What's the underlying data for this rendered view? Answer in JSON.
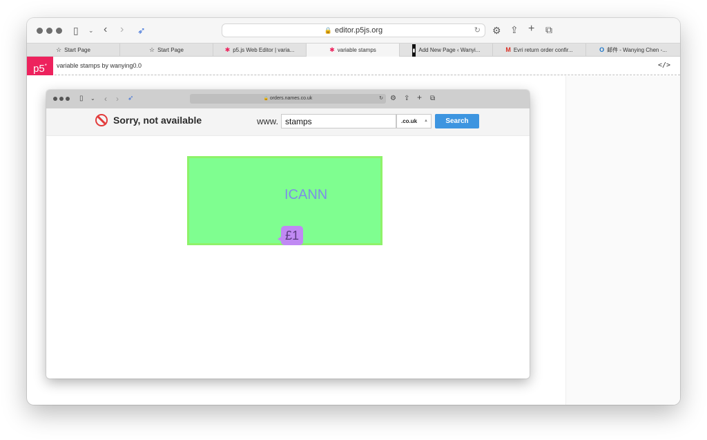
{
  "outer": {
    "url": "editor.p5js.org",
    "tabs": [
      {
        "label": "Start Page",
        "icon": "star-icon"
      },
      {
        "label": "Start Page",
        "icon": "star-icon"
      },
      {
        "label": "p5.js Web Editor | varia...",
        "icon": "p5-asterisk-icon"
      },
      {
        "label": "variable stamps",
        "icon": "p5-asterisk-icon",
        "active": true
      },
      {
        "label": "Add New Page ‹ Wanyi...",
        "icon": "wordpress-icon"
      },
      {
        "label": "Evri return order confir...",
        "icon": "gmail-icon"
      },
      {
        "label": "邮件 - Wanying Chen -...",
        "icon": "outlook-icon"
      }
    ]
  },
  "p5": {
    "logo": "p5",
    "logo_sup": "*",
    "sketch_title": "variable stamps by wanying0.0",
    "code_toggle": "</>"
  },
  "inner": {
    "url": "orders.names.co.uk",
    "sorry_text": "Sorry, not available",
    "www_label": "www.",
    "search_value": "stamps",
    "tld_value": ".co.uk",
    "search_button": "Search"
  },
  "stamp": {
    "text": "ICANN",
    "price": "£1",
    "colors": {
      "background": "#7ffe90",
      "border": "#8ef26a",
      "text": "#7c8fe6",
      "bubble": "#c089f3"
    }
  },
  "colors": {
    "p5_brand": "#ed225d",
    "search_button": "#3d95e0",
    "not_available": "#e23b3b"
  }
}
